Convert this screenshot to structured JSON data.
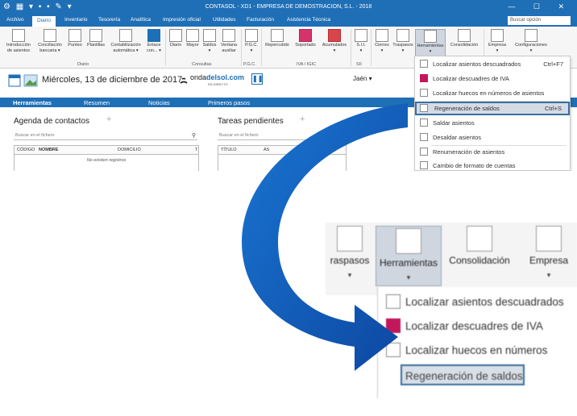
{
  "app": {
    "title": "CONTASOL - XD1 - EMPRESA DE DEMOSTRACION, S.L. - 2018",
    "quick_access": "⚙ ▦ ▾ ▪ ▪ ✎ ▾",
    "window_controls": "— ☐ ✕",
    "search_placeholder": "Buscar opción",
    "accent_color": "#1f6fb6"
  },
  "menu": {
    "tabs": [
      "Archivo",
      "Diario",
      "Inventario",
      "Tesorería",
      "Analítica",
      "Impresión oficial",
      "Utilidades",
      "Facturación",
      "Asistencia Técnica"
    ],
    "active": "Diario"
  },
  "ribbon": {
    "buttons": [
      {
        "label1": "Introducción",
        "label2": "de asientos"
      },
      {
        "label1": "Conciliación",
        "label2": "bancaria ▾"
      },
      {
        "label1": "Punteo",
        "label2": ""
      },
      {
        "label1": "Plantillas",
        "label2": ""
      },
      {
        "label1": "Contabilización",
        "label2": "automática ▾"
      },
      {
        "label1": "Enlace",
        "label2": "con... ▾"
      },
      {
        "label1": "Diario",
        "label2": ""
      },
      {
        "label1": "Mayor",
        "label2": ""
      },
      {
        "label1": "Saldos",
        "label2": "▾"
      },
      {
        "label1": "Ventana",
        "label2": "auxiliar"
      },
      {
        "label1": "P.G.C.",
        "label2": "▾"
      },
      {
        "label1": "Repercutido",
        "label2": ""
      },
      {
        "label1": "Soportado",
        "label2": ""
      },
      {
        "label1": "Acumulados",
        "label2": "▾"
      },
      {
        "label1": "S.I.I.",
        "label2": "▾"
      },
      {
        "label1": "Cierres",
        "label2": "▾"
      },
      {
        "label1": "Traspasos",
        "label2": "▾"
      },
      {
        "label1": "Herramientas",
        "label2": "▾"
      },
      {
        "label1": "Consolidación",
        "label2": ""
      },
      {
        "label1": "Empresa",
        "label2": "▾"
      },
      {
        "label1": "Configuraciones",
        "label2": "▾"
      }
    ],
    "groups": [
      "Diario",
      "Consultas",
      "P.G.C.",
      "IVA / IGIC",
      "SII"
    ]
  },
  "strip": {
    "date": "Miércoles, 13 de diciembre de 2017",
    "brand_prefix": "onda",
    "brand_main": "delsol.com",
    "brand_sub": "EN DIRECTO",
    "pause_icon": "❚❚",
    "region": "Jaén ▾"
  },
  "hometabs": [
    "Herramientas",
    "Resumen",
    "Noticias",
    "Primeros pasos"
  ],
  "contacts": {
    "title": "Agenda de contactos",
    "search_placeholder": "Buscar en el fichero",
    "columns": [
      "CÓDIGO",
      "NOMBRE",
      "DOMICILIO",
      "T"
    ],
    "empty": "No existen registros"
  },
  "tasks": {
    "title": "Tareas pendientes",
    "search_placeholder": "Buscar en el fichero",
    "columns": [
      "TÍTULO",
      "AS"
    ],
    "empty": "No"
  },
  "dropdown": {
    "items": [
      {
        "label": "Localizar asientos descuadrados",
        "shortcut": "Ctrl+F7"
      },
      {
        "label": "Localizar descuadres de IVA",
        "shortcut": ""
      },
      {
        "label": "Localizar huecos en números de asientos",
        "shortcut": ""
      },
      {
        "label": "Regeneración de saldos",
        "shortcut": "Ctrl+S"
      },
      {
        "label": "Saldar asientos",
        "shortcut": ""
      },
      {
        "label": "Desaldar asientos",
        "shortcut": ""
      },
      {
        "label": "Renumeración de asientos",
        "shortcut": ""
      },
      {
        "label": "Cambio de formato de cuentas",
        "shortcut": ""
      }
    ],
    "highlighted_index": 3
  },
  "zoom": {
    "buttons": [
      "raspasos",
      "Herramientas",
      "Consolidación",
      "Empresa"
    ],
    "items": [
      "Localizar asientos descuadrados",
      "Localizar descuadres de IVA",
      "Localizar huecos en números",
      "Regeneración de saldos"
    ]
  },
  "arrow_color": "#1565c0"
}
